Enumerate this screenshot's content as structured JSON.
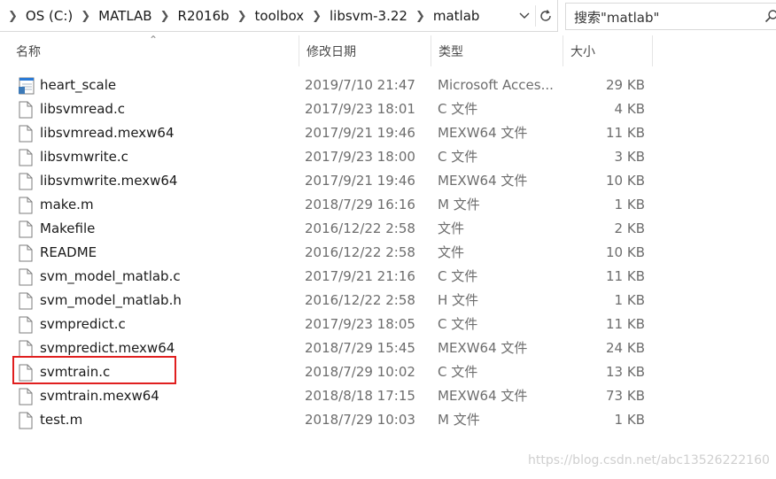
{
  "address": {
    "crumbs": [
      "OS (C:)",
      "MATLAB",
      "R2016b",
      "toolbox",
      "libsvm-3.22",
      "matlab"
    ]
  },
  "search": {
    "placeholder": "搜索\"matlab\""
  },
  "columns": {
    "name": "名称",
    "date": "修改日期",
    "type": "类型",
    "size": "大小"
  },
  "files": [
    {
      "name": "heart_scale",
      "date": "2019/7/10 21:47",
      "type": "Microsoft Acces...",
      "size": "29 KB",
      "icon": "access-file-icon"
    },
    {
      "name": "libsvmread.c",
      "date": "2017/9/23 18:01",
      "type": "C 文件",
      "size": "4 KB",
      "icon": "file-icon"
    },
    {
      "name": "libsvmread.mexw64",
      "date": "2017/9/21 19:46",
      "type": "MEXW64 文件",
      "size": "11 KB",
      "icon": "file-icon"
    },
    {
      "name": "libsvmwrite.c",
      "date": "2017/9/23 18:00",
      "type": "C 文件",
      "size": "3 KB",
      "icon": "file-icon"
    },
    {
      "name": "libsvmwrite.mexw64",
      "date": "2017/9/21 19:46",
      "type": "MEXW64 文件",
      "size": "10 KB",
      "icon": "file-icon"
    },
    {
      "name": "make.m",
      "date": "2018/7/29 16:16",
      "type": "M 文件",
      "size": "1 KB",
      "icon": "file-icon"
    },
    {
      "name": "Makefile",
      "date": "2016/12/22 2:58",
      "type": "文件",
      "size": "2 KB",
      "icon": "file-icon"
    },
    {
      "name": "README",
      "date": "2016/12/22 2:58",
      "type": "文件",
      "size": "10 KB",
      "icon": "file-icon"
    },
    {
      "name": "svm_model_matlab.c",
      "date": "2017/9/21 21:16",
      "type": "C 文件",
      "size": "11 KB",
      "icon": "file-icon"
    },
    {
      "name": "svm_model_matlab.h",
      "date": "2016/12/22 2:58",
      "type": "H 文件",
      "size": "1 KB",
      "icon": "file-icon"
    },
    {
      "name": "svmpredict.c",
      "date": "2017/9/23 18:05",
      "type": "C 文件",
      "size": "11 KB",
      "icon": "file-icon"
    },
    {
      "name": "svmpredict.mexw64",
      "date": "2018/7/29 15:45",
      "type": "MEXW64 文件",
      "size": "24 KB",
      "icon": "file-icon"
    },
    {
      "name": "svmtrain.c",
      "date": "2018/7/29 10:02",
      "type": "C 文件",
      "size": "13 KB",
      "icon": "file-icon",
      "highlighted": true
    },
    {
      "name": "svmtrain.mexw64",
      "date": "2018/8/18 17:15",
      "type": "MEXW64 文件",
      "size": "73 KB",
      "icon": "file-icon"
    },
    {
      "name": "test.m",
      "date": "2018/7/29 10:03",
      "type": "M 文件",
      "size": "1 KB",
      "icon": "file-icon"
    }
  ],
  "highlight_color": "#e01f1f",
  "watermark": "https://blog.csdn.net/abc13526222160"
}
